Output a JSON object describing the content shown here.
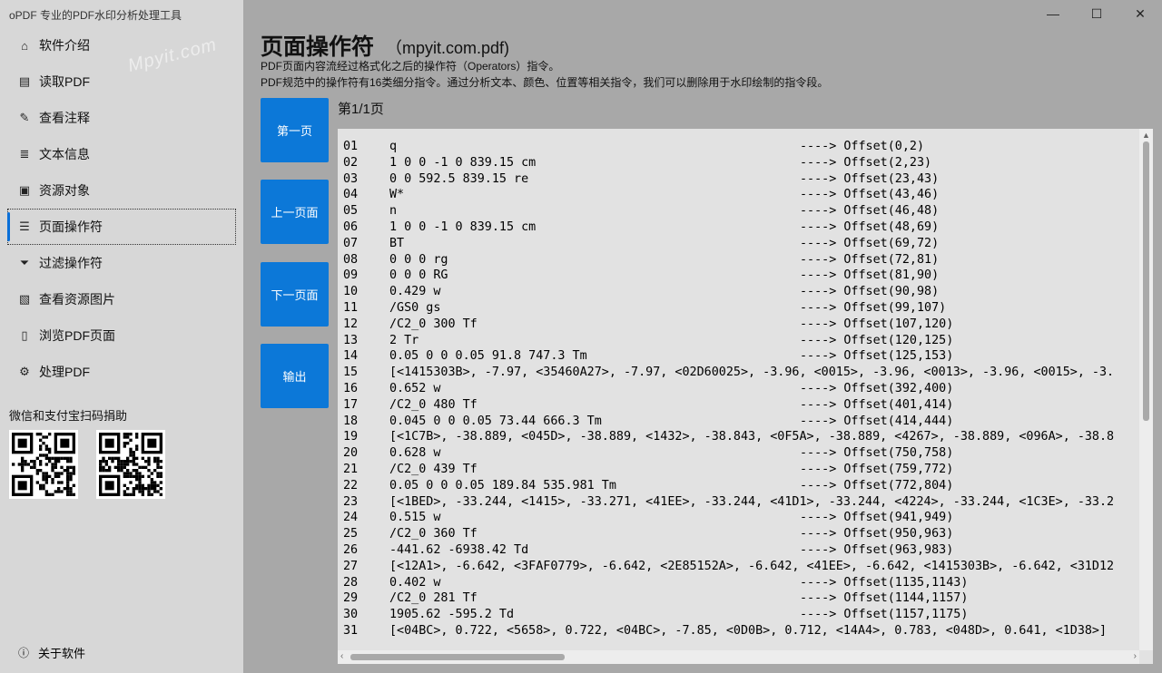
{
  "app": {
    "title": "oPDF 专业的PDF水印分析处理工具"
  },
  "window_controls": {
    "minimize": "—",
    "maximize": "☐",
    "close": "✕"
  },
  "sidebar": {
    "items": [
      {
        "label": "软件介绍",
        "icon": "home-icon",
        "glyph": "⌂"
      },
      {
        "label": "读取PDF",
        "icon": "open-file-icon",
        "glyph": "▤"
      },
      {
        "label": "查看注释",
        "icon": "edit-note-icon",
        "glyph": "✎"
      },
      {
        "label": "文本信息",
        "icon": "text-lines-icon",
        "glyph": "≣"
      },
      {
        "label": "资源对象",
        "icon": "resource-icon",
        "glyph": "▣"
      },
      {
        "label": "页面操作符",
        "icon": "list-icon",
        "glyph": "☰",
        "active": true
      },
      {
        "label": "过滤操作符",
        "icon": "filter-icon",
        "glyph": "⏷"
      },
      {
        "label": "查看资源图片",
        "icon": "image-icon",
        "glyph": "▧"
      },
      {
        "label": "浏览PDF页面",
        "icon": "page-icon",
        "glyph": "▯"
      },
      {
        "label": "处理PDF",
        "icon": "gear-icon",
        "glyph": "⚙"
      }
    ],
    "donate_label": "微信和支付宝扫码捐助",
    "about_label": "关于软件",
    "about_glyph": "ⓘ"
  },
  "watermarks": [
    "Mpyit.com",
    "Mpyit.com",
    "Mpyit.com"
  ],
  "main": {
    "title": "页面操作符",
    "file": "（mpyit.com.pdf)",
    "desc_line1": "PDF页面内容流经过格式化之后的操作符（Operators）指令。",
    "desc_line2": "PDF规范中的操作符有16类细分指令。通过分析文本、颜色、位置等相关指令，我们可以删除用于水印绘制的指令段。",
    "page_info": "第1/1页",
    "buttons": {
      "first": "第一页",
      "prev": "上一页面",
      "next": "下一页面",
      "export": "输出"
    }
  },
  "operators": [
    {
      "n": "01",
      "op": "q",
      "off": "----> Offset(0,2)"
    },
    {
      "n": "02",
      "op": "1 0 0 -1 0 839.15 cm",
      "off": "----> Offset(2,23)"
    },
    {
      "n": "03",
      "op": "0 0 592.5 839.15 re",
      "off": "----> Offset(23,43)"
    },
    {
      "n": "04",
      "op": "W*",
      "off": "----> Offset(43,46)"
    },
    {
      "n": "05",
      "op": "n",
      "off": "----> Offset(46,48)"
    },
    {
      "n": "06",
      "op": "1 0 0 -1 0 839.15 cm",
      "off": "----> Offset(48,69)"
    },
    {
      "n": "07",
      "op": "BT",
      "off": "----> Offset(69,72)"
    },
    {
      "n": "08",
      "op": "0 0 0 rg",
      "off": "----> Offset(72,81)"
    },
    {
      "n": "09",
      "op": "0 0 0 RG",
      "off": "----> Offset(81,90)"
    },
    {
      "n": "10",
      "op": "0.429 w",
      "off": "----> Offset(90,98)"
    },
    {
      "n": "11",
      "op": "/GS0 gs",
      "off": "----> Offset(99,107)"
    },
    {
      "n": "12",
      "op": "/C2_0 300 Tf",
      "off": "----> Offset(107,120)"
    },
    {
      "n": "13",
      "op": "2 Tr",
      "off": "----> Offset(120,125)"
    },
    {
      "n": "14",
      "op": "0.05 0 0 0.05 91.8 747.3 Tm",
      "off": "----> Offset(125,153)"
    },
    {
      "n": "15",
      "op": "[<1415303B>, -7.97, <35460A27>, -7.97, <02D60025>, -3.96, <0015>, -3.96, <0013>, -3.96, <0015>, -3.",
      "off": ""
    },
    {
      "n": "16",
      "op": "0.652 w",
      "off": "----> Offset(392,400)"
    },
    {
      "n": "17",
      "op": "/C2_0 480 Tf",
      "off": "----> Offset(401,414)"
    },
    {
      "n": "18",
      "op": "0.045 0 0 0.05 73.44 666.3 Tm",
      "off": "----> Offset(414,444)"
    },
    {
      "n": "19",
      "op": "[<1C7B>, -38.889, <045D>, -38.889, <1432>, -38.843, <0F5A>, -38.889, <4267>, -38.889, <096A>, -38.8",
      "off": ""
    },
    {
      "n": "20",
      "op": "0.628 w",
      "off": "----> Offset(750,758)"
    },
    {
      "n": "21",
      "op": "/C2_0 439 Tf",
      "off": "----> Offset(759,772)"
    },
    {
      "n": "22",
      "op": "0.05 0 0 0.05 189.84 535.981 Tm",
      "off": "----> Offset(772,804)"
    },
    {
      "n": "23",
      "op": "[<1BED>, -33.244, <1415>, -33.271, <41EE>, -33.244, <41D1>, -33.244, <4224>, -33.244, <1C3E>, -33.2",
      "off": ""
    },
    {
      "n": "24",
      "op": "0.515 w",
      "off": "----> Offset(941,949)"
    },
    {
      "n": "25",
      "op": "/C2_0 360 Tf",
      "off": "----> Offset(950,963)"
    },
    {
      "n": "26",
      "op": "-441.62 -6938.42 Td",
      "off": "----> Offset(963,983)"
    },
    {
      "n": "27",
      "op": "[<12A1>, -6.642, <3FAF0779>, -6.642, <2E85152A>, -6.642, <41EE>, -6.642, <1415303B>, -6.642, <31D12",
      "off": ""
    },
    {
      "n": "28",
      "op": "0.402 w",
      "off": "----> Offset(1135,1143)"
    },
    {
      "n": "29",
      "op": "/C2_0 281 Tf",
      "off": "----> Offset(1144,1157)"
    },
    {
      "n": "30",
      "op": "1905.62 -595.2 Td",
      "off": "----> Offset(1157,1175)"
    },
    {
      "n": "31",
      "op": "[<04BC>, 0.722, <5658>, 0.722, <04BC>, -7.85, <0D0B>, 0.712, <14A4>, 0.783, <048D>, 0.641, <1D38>]",
      "off": ""
    }
  ],
  "scroll": {
    "up": "▲",
    "left": "‹",
    "right": "›"
  },
  "colors": {
    "accent": "#0c78d8",
    "sidebar_bg": "#d7d7d7",
    "main_bg": "#a8a8a8",
    "code_bg": "#e2e2e2"
  }
}
